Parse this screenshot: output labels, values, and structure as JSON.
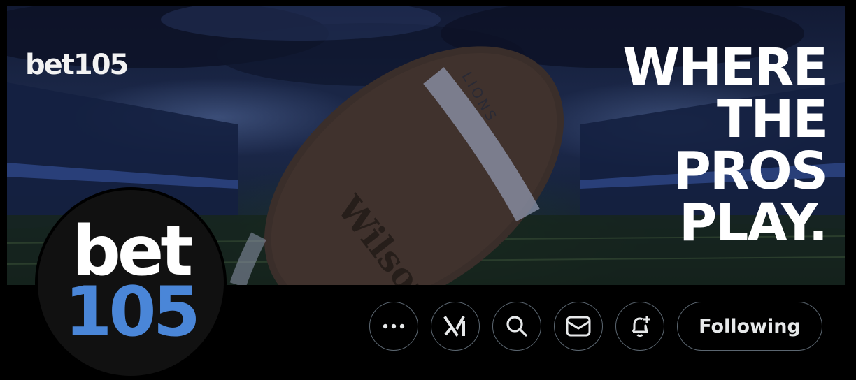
{
  "banner": {
    "logo_text": "bet105",
    "headline_lines": [
      "WHERE",
      "THE",
      "PROS",
      "PLAY."
    ],
    "ball_texts": [
      "Wilson",
      "LIONS"
    ]
  },
  "avatar": {
    "line1": "bet",
    "line2": "105",
    "accent_color": "#4a86d8"
  },
  "actions": {
    "more_icon": "more-horizontal-icon",
    "grok_icon": "grok-icon",
    "search_icon": "search-icon",
    "message_icon": "envelope-icon",
    "notify_icon": "bell-plus-icon",
    "follow_label": "Following"
  },
  "colors": {
    "background": "#000000",
    "border": "#5b6670",
    "accent": "#4a86d8"
  }
}
